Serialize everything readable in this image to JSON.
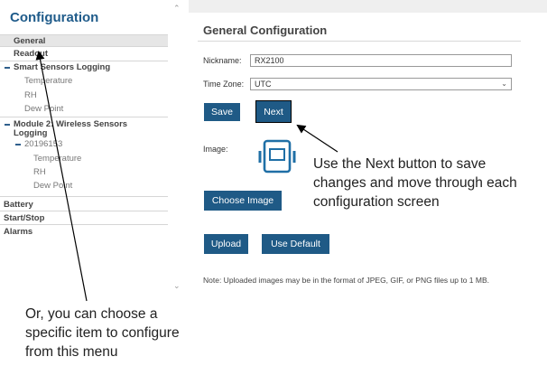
{
  "sidebar": {
    "title": "Configuration",
    "general": "General",
    "readout": "Readout",
    "smart_sensors": "Smart Sensors Logging",
    "smart_items": [
      "Temperature",
      "RH",
      "Dew Point"
    ],
    "module2_line1": "Module 2: Wireless Sensors",
    "module2_line2": "Logging",
    "sensor_id": "20196153",
    "sensor_items": [
      "Temperature",
      "RH",
      "Dew Point"
    ],
    "battery": "Battery",
    "startstop": "Start/Stop",
    "alarms": "Alarms"
  },
  "main": {
    "title": "General Configuration",
    "nickname_label": "Nickname:",
    "nickname_value": "RX2100",
    "timezone_label": "Time Zone:",
    "timezone_value": "UTC",
    "save": "Save",
    "next": "Next",
    "image_label": "Image:",
    "choose_image": "Choose Image",
    "upload": "Upload",
    "use_default": "Use Default",
    "note": "Note: Uploaded images may be in the format of JPEG, GIF, or PNG files up to 1 MB."
  },
  "callouts": {
    "next_line1": "Use the Next button to save",
    "next_line2": "changes and move through each",
    "next_line3": "configuration screen",
    "menu_line1": "Or, you can choose a",
    "menu_line2": "specific item to configure",
    "menu_line3": "from this menu"
  },
  "colors": {
    "accent": "#1f5a86",
    "title": "#1f5b8a"
  }
}
